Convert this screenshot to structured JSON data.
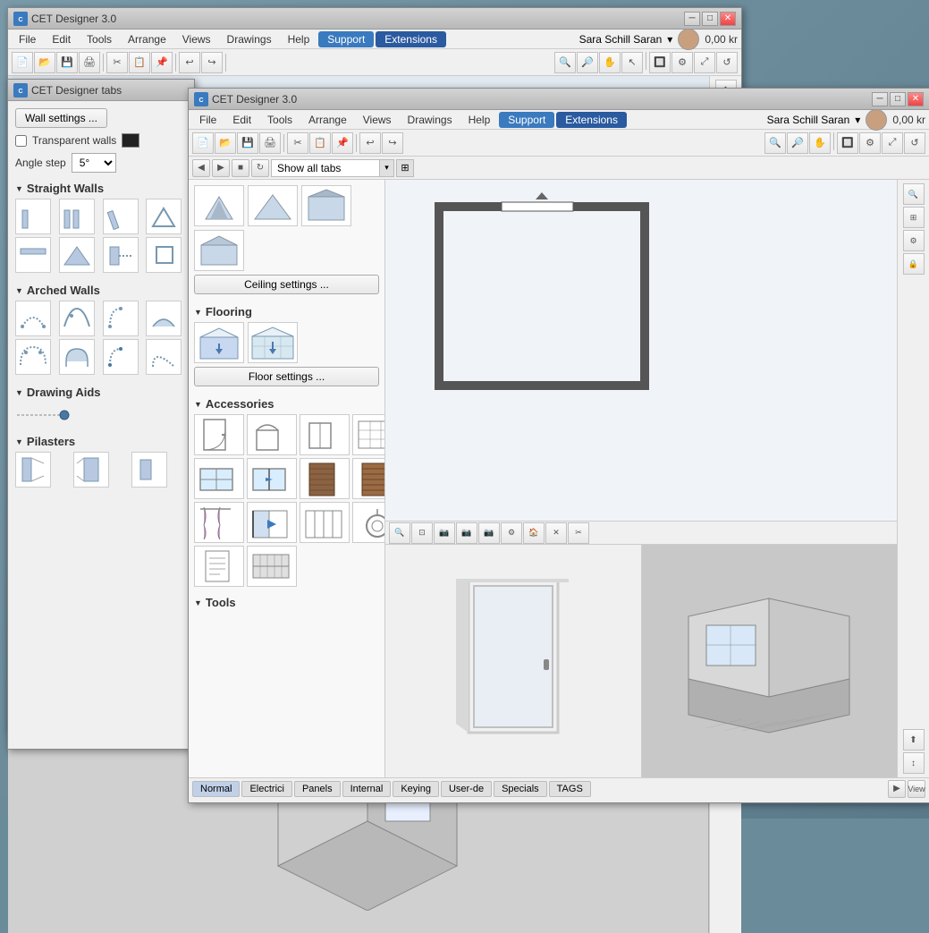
{
  "app": {
    "title": "CET Designer 3.0",
    "icon": "CET"
  },
  "main_window": {
    "title": "CET Designer 3.0",
    "menus": [
      "File",
      "Edit",
      "Tools",
      "Arrange",
      "Views",
      "Drawings",
      "Help"
    ],
    "support_btn": "Support",
    "extensions_btn": "Extensions",
    "user": "Sara Schill Saran",
    "price": "0,00 kr"
  },
  "secondary_window": {
    "title": "CET Designer 3.0",
    "menus": [
      "File",
      "Edit",
      "Tools",
      "Arrange",
      "Views",
      "Drawings",
      "Help"
    ],
    "support_btn": "Support",
    "extensions_btn": "Extensions",
    "user": "Sara Schill Saran",
    "price": "0,00 kr"
  },
  "left_panel": {
    "title": "CET Designer tabs",
    "wall_settings_btn": "Wall settings ...",
    "transparent_walls": "Transparent walls",
    "angle_step_label": "Angle step",
    "angle_step_value": "5°",
    "straight_walls_header": "Straight Walls",
    "arched_walls_header": "Arched Walls",
    "drawing_aids_header": "Drawing Aids",
    "pilasters_header": "Pilasters"
  },
  "tool_panel": {
    "show_all_tabs": "Show all tabs",
    "ceiling_settings_btn": "Ceiling settings ...",
    "flooring_header": "Flooring",
    "floor_settings_btn": "Floor settings ...",
    "accessories_header": "Accessories",
    "tools_header": "Tools"
  },
  "status_bar": {
    "tabs": [
      "Normal",
      "Electrici",
      "Panels",
      "Internal",
      "Keying",
      "User-de",
      "Specials",
      "TAGS"
    ]
  },
  "ceiling_items": [
    "🔷",
    "⬜",
    "◼",
    "▽"
  ],
  "wall_items_straight": [
    {
      "shape": "wall1"
    },
    {
      "shape": "wall2"
    },
    {
      "shape": "wall3"
    },
    {
      "shape": "wall4"
    },
    {
      "shape": "wall5"
    },
    {
      "shape": "wall6"
    },
    {
      "shape": "wall7"
    },
    {
      "shape": "wall8"
    }
  ],
  "wall_items_arched": [
    {
      "shape": "arch1"
    },
    {
      "shape": "arch2"
    },
    {
      "shape": "arch3"
    },
    {
      "shape": "arch4"
    },
    {
      "shape": "arch5"
    },
    {
      "shape": "arch6"
    },
    {
      "shape": "arch7"
    },
    {
      "shape": "arch8"
    }
  ],
  "acc_items": [
    {
      "icon": "🚪"
    },
    {
      "icon": "⬜"
    },
    {
      "icon": "▭"
    },
    {
      "icon": "⊞"
    },
    {
      "icon": "🪟"
    },
    {
      "icon": "↔"
    },
    {
      "icon": "🟫"
    },
    {
      "icon": "🟧"
    },
    {
      "icon": "🪟"
    },
    {
      "icon": "↕"
    },
    {
      "icon": "↔"
    },
    {
      "icon": ""
    },
    {
      "icon": "⬟"
    },
    {
      "icon": "🏛"
    },
    {
      "icon": "⊟"
    },
    {
      "icon": ""
    },
    {
      "icon": "🔲"
    },
    {
      "icon": "📄"
    },
    {
      "icon": "🔥"
    }
  ]
}
